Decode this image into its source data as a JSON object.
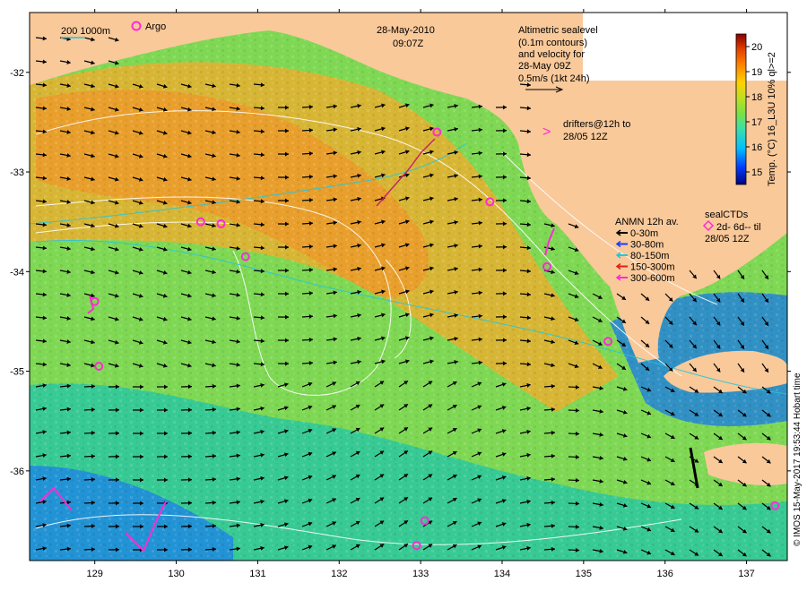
{
  "header": {
    "date": "28-May-2010",
    "time": "09:07Z"
  },
  "legend_topleft": {
    "contour_label": "200  1000m",
    "argo_label": "Argo"
  },
  "altimetry_note": {
    "lines": [
      "Altimetric sealevel",
      "(0.1m contours)",
      "and velocity for",
      "28-May 09Z",
      "0.5m/s (1kt 24h)"
    ]
  },
  "drifters_note": {
    "symbol": ">",
    "line1": "drifters@12h to",
    "line2": "28/05 12Z"
  },
  "anmn_legend": {
    "title": "ANMN 12h av.",
    "items": [
      {
        "label": "0-30m",
        "color": "#000000"
      },
      {
        "label": "30-80m",
        "color": "#1a3cff"
      },
      {
        "label": "80-150m",
        "color": "#26c6da"
      },
      {
        "label": "150-300m",
        "color": "#e0201a"
      },
      {
        "label": "300-600m",
        "color": "#ff2bd6"
      }
    ]
  },
  "sealctd_legend": {
    "title": "sealCTDs",
    "line1": "2d- 6d-- til",
    "line2": "28/05 12Z"
  },
  "colorbar": {
    "ticks": [
      "15",
      "16",
      "17",
      "18",
      "19",
      "20"
    ],
    "title": "Temp. (°C) 16_L3U 10% ql>=2",
    "vmin": 14.5,
    "vmax": 20.5,
    "stops": [
      "#00007f",
      "#0040ff",
      "#00c0ff",
      "#40e0a0",
      "#80e040",
      "#c0e020",
      "#ffd000",
      "#ff8000",
      "#e04000",
      "#8b0000"
    ]
  },
  "credit": "© IMOS 15-May-2017 19:53:44 Hobart time",
  "axes": {
    "x_ticks": [
      "129",
      "130",
      "131",
      "132",
      "133",
      "134",
      "135",
      "136",
      "137"
    ],
    "y_ticks": [
      "-32",
      "-33",
      "-34",
      "-35",
      "-36"
    ],
    "xlim": [
      128.2,
      137.5
    ],
    "ylim": [
      -36.9,
      -31.4
    ]
  },
  "colors": {
    "land": "#f9c99a",
    "warm": "#f0a030",
    "mid": "#9be040",
    "cool": "#20c890",
    "cold": "#1aa0e8",
    "argo": "#ff2bd6"
  },
  "argo_floats": [
    {
      "lon": 133.2,
      "lat": -32.6
    },
    {
      "lon": 133.85,
      "lat": -33.3
    },
    {
      "lon": 134.55,
      "lat": -33.95
    },
    {
      "lon": 135.3,
      "lat": -34.7
    },
    {
      "lon": 130.3,
      "lat": -33.5
    },
    {
      "lon": 130.55,
      "lat": -33.52
    },
    {
      "lon": 130.85,
      "lat": -33.85
    },
    {
      "lon": 129.05,
      "lat": -34.95
    },
    {
      "lon": 129.0,
      "lat": -34.3
    },
    {
      "lon": 133.05,
      "lat": -36.5
    },
    {
      "lon": 132.95,
      "lat": -36.75
    },
    {
      "lon": 137.35,
      "lat": -36.35
    }
  ]
}
